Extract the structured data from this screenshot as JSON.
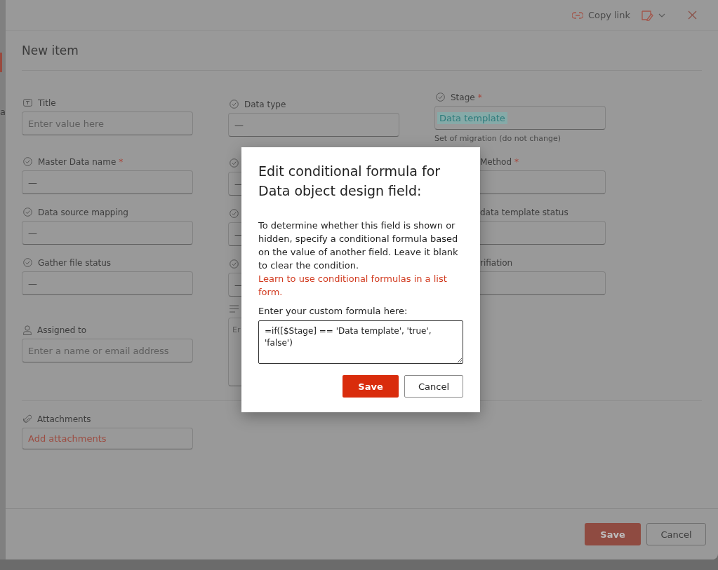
{
  "backdrop_fragment": "a",
  "header": {
    "copy_link": "Copy link"
  },
  "title": "New item",
  "columns": [
    [
      {
        "kind": "text",
        "label": "Title",
        "placeholder": "Enter value here"
      },
      {
        "kind": "choice",
        "label": "Master Data name",
        "required_mark": "*",
        "value": "—"
      },
      {
        "kind": "choice",
        "label": "Data source mapping",
        "value": "—"
      },
      {
        "kind": "choice",
        "label": "Gather file status",
        "value": "—"
      },
      {
        "kind": "person",
        "label": "Assigned to",
        "placeholder": "Enter a name or email address"
      }
    ],
    [
      {
        "kind": "choice",
        "label": "Data type",
        "value": "—"
      },
      {
        "kind": "choice",
        "value": "—"
      },
      {
        "kind": "choice",
        "value": "—"
      },
      {
        "kind": "choice",
        "value": "—"
      },
      {
        "kind": "multiline",
        "placeholder": "Er"
      }
    ],
    [
      {
        "kind": "choice",
        "label": "Stage",
        "required_mark": "*",
        "value": "Data template",
        "value_selected": true,
        "hint": "Set of migration (do not change)"
      },
      {
        "kind": "choice",
        "label": "Method",
        "required_mark": "*",
        "icon_hidden": true
      },
      {
        "kind": "choice",
        "label": "data template status",
        "icon_hidden": true
      },
      {
        "kind": "choice",
        "label": "rifiation",
        "icon_hidden": true
      }
    ]
  ],
  "attachments": {
    "label": "Attachments",
    "button": "Add attachments"
  },
  "footer_buttons": [
    {
      "label": "Save",
      "kind": "primary"
    },
    {
      "label": "Cancel",
      "kind": "secondary"
    }
  ],
  "dialog": {
    "title": "Edit conditional formula for Data object design field:",
    "description": "To determine whether this field is shown or hidden, specify a conditional formula based on the value of another field. Leave it blank to clear the condition.",
    "link": "Learn to use conditional formulas in a list form.",
    "formula_label": "Enter your custom formula here:",
    "formula": "=if([$Stage] == 'Data template', 'true', 'false')",
    "buttons": [
      {
        "label": "Save",
        "kind": "primary"
      },
      {
        "label": "Cancel",
        "kind": "secondary"
      }
    ]
  }
}
